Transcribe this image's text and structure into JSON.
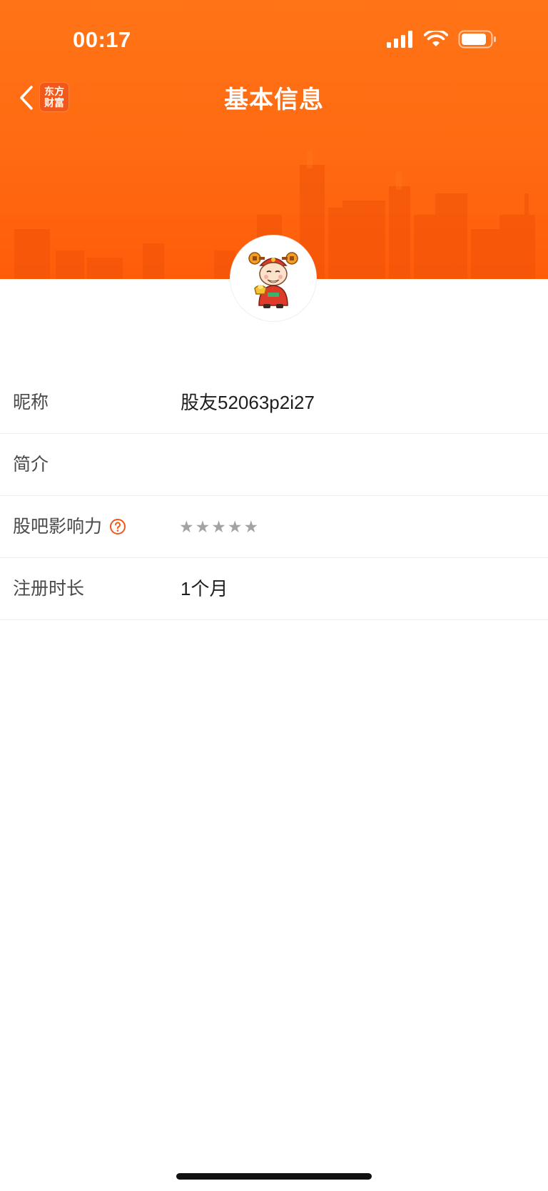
{
  "status_bar": {
    "time": "00:17"
  },
  "header": {
    "title": "基本信息",
    "brand_logo_line1": "东方",
    "brand_logo_line2": "财富"
  },
  "icons": {
    "back": "chevron-left-icon",
    "signal": "signal-icon",
    "wifi": "wifi-icon",
    "battery": "battery-icon",
    "help": "question-circle-icon",
    "avatar": "god-of-wealth-avatar"
  },
  "profile": {
    "rows": [
      {
        "label": "昵称",
        "value": "股友52063p2i27"
      },
      {
        "label": "简介",
        "value": ""
      },
      {
        "label": "股吧影响力",
        "stars": [
          "★",
          "★",
          "★",
          "★",
          "★"
        ],
        "rating": 0
      },
      {
        "label": "注册时长",
        "value": "1个月"
      }
    ]
  },
  "colors": {
    "header_orange": "#ff6a12",
    "accent_orange": "#f2581a",
    "star_gray": "#a3a3a3",
    "label_gray": "#4a4a4a",
    "value_dark": "#1e1e1e"
  }
}
